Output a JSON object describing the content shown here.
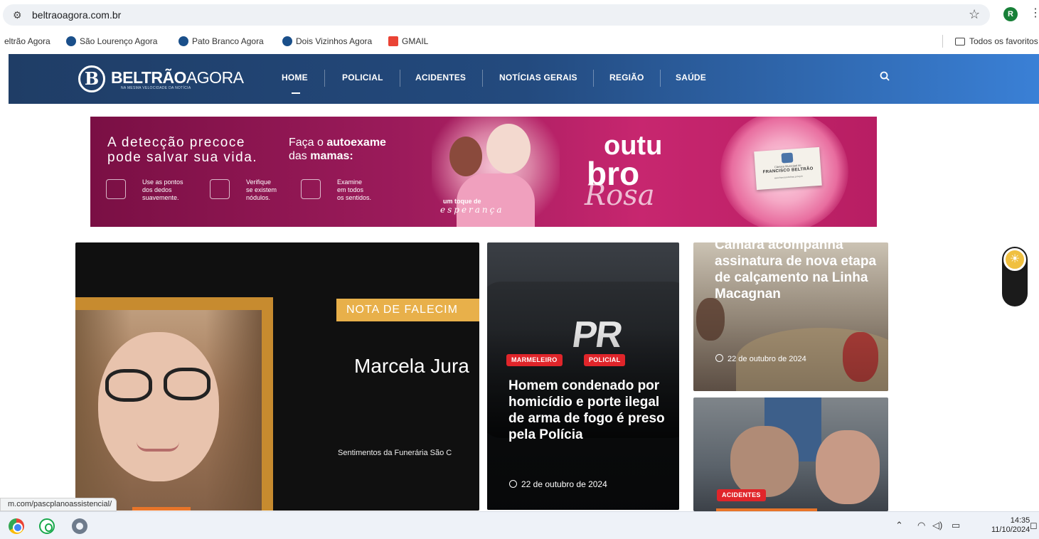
{
  "browser": {
    "url": "beltraoagora.com.br",
    "profile_initial": "R"
  },
  "bookmarks": [
    {
      "label": "eltrão Agora"
    },
    {
      "label": "São Lourenço Agora"
    },
    {
      "label": "Pato Branco Agora"
    },
    {
      "label": "Dois Vizinhos Agora"
    },
    {
      "label": "GMAIL"
    }
  ],
  "bookmarks_folder": "Todos os favoritos",
  "site": {
    "logo_bold": "BELTRÃO",
    "logo_light": "AGORA",
    "logo_tagline": "NA MESMA VELOCIDADE DA NOTÍCIA",
    "nav": [
      "HOME",
      "POLICIAL",
      "ACIDENTES",
      "NOTÍCIAS GERAIS",
      "REGIÃO",
      "SAÚDE"
    ]
  },
  "banner": {
    "line1": "A detecção precoce",
    "line2": "pode salvar sua vida.",
    "cta1_a": "Faça o ",
    "cta1_b": "autoexame",
    "cta2_a": "das ",
    "cta2_b": "mamas:",
    "tips": [
      "Use as pontos\ndos dedos\nsuavemente.",
      "Verifique\nse existem\nnódulos.",
      "Examine\nem todos\nos sentidos."
    ],
    "toque": "um toque de",
    "esperanca": "esperança",
    "outu": "outu",
    "bro": "bro",
    "rosa": "Rosa",
    "seal_top": "Câmara Municipal de",
    "seal_name": "FRANCISCO BELTRÃO",
    "seal_sub": "www.franciscobeltrao.pr.leg.br"
  },
  "cards": {
    "obituary": {
      "label": "NOTA DE FALECIM",
      "name": "Marcela Jura",
      "sub": "Sentimentos da Funerária São C"
    },
    "police": {
      "tags": [
        "MARMELEIRO",
        "POLICIAL"
      ],
      "title": "Homem condenado por homicídio e porte ilegal de arma de fogo é preso pela Polícia",
      "date": "22 de outubro de 2024"
    },
    "camara": {
      "title": "Câmara acompanha assinatura de nova etapa de calçamento na Linha Macagnan",
      "date": "22 de outubro de 2024"
    },
    "accident": {
      "tag": "ACIDENTES"
    }
  },
  "status_url": "m.com/pascplanoassistencial/",
  "taskbar": {
    "time": "14:35",
    "date": "11/10/2024"
  }
}
